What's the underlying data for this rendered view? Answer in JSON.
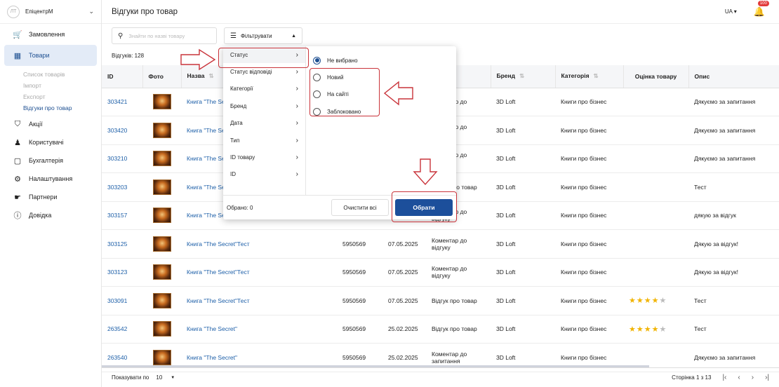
{
  "sidebar": {
    "avatar": "ЛТ",
    "company": "ЕпіцентрМ",
    "items": [
      {
        "label": "Замовлення",
        "icon": "cart-icon"
      },
      {
        "label": "Товари",
        "icon": "box-icon"
      },
      {
        "label": "Акції",
        "icon": "promo-icon"
      },
      {
        "label": "Користувачі",
        "icon": "users-icon"
      },
      {
        "label": "Бухгалтерія",
        "icon": "wallet-icon"
      },
      {
        "label": "Налаштування",
        "icon": "gear-icon"
      },
      {
        "label": "Партнери",
        "icon": "handshake-icon"
      },
      {
        "label": "Довідка",
        "icon": "help-icon"
      }
    ],
    "subitems": [
      "Список товарів",
      "Імпорт",
      "Експорт",
      "Відгуки про товар"
    ]
  },
  "header": {
    "title": "Відгуки про товар",
    "lang": "UA",
    "notif_count": "100"
  },
  "toolbar": {
    "search_placeholder": "Знайти по назві товару",
    "filter_label": "Фільтрувати"
  },
  "count_label": "Відгуків: 128",
  "table": {
    "headers": {
      "id": "ID",
      "photo": "Фото",
      "name": "Назва",
      "brand": "Бренд",
      "category": "Категорія",
      "rating": "Оцінка товару",
      "desc": "Опис"
    },
    "rows": [
      {
        "id": "303421",
        "name": "Книга \"The Secret\"Тесть",
        "code": "",
        "date": "",
        "type": "Коментар до",
        "brand": "3D Loft",
        "category": "Книги про бізнес",
        "rating": 0,
        "desc": "Дякуємо за запитання"
      },
      {
        "id": "303420",
        "name": "Книга \"The Secret\"Тесть",
        "code": "",
        "date": "",
        "type": "Коментар до відгуку",
        "brand": "3D Loft",
        "category": "Книги про бізнес",
        "rating": 0,
        "desc": "Дякуємо за запитання"
      },
      {
        "id": "303210",
        "name": "Книга \"The Secret\"Тест",
        "code": "",
        "date": "",
        "type": "Коментар до відгуку",
        "brand": "3D Loft",
        "category": "Книги про бізнес",
        "rating": 0,
        "desc": "Дякуємо за запитання"
      },
      {
        "id": "303203",
        "name": "Книга \"The Secret\"Тест",
        "code": "",
        "date": "",
        "type": "Відгук про товар",
        "brand": "3D Loft",
        "category": "Книги про бізнес",
        "rating": 0,
        "desc": "Тест"
      },
      {
        "id": "303157",
        "name": "Книга \"The Secret\"Тест",
        "code": "",
        "date": "",
        "type": "Коментар до відгуку",
        "brand": "3D Loft",
        "category": "Книги про бізнес",
        "rating": 0,
        "desc": "дякую за відгук"
      },
      {
        "id": "303125",
        "name": "Книга \"The Secret\"Тест",
        "code": "5950569",
        "date": "07.05.2025",
        "type": "Коментар до відгуку",
        "brand": "3D Loft",
        "category": "Книги про бізнес",
        "rating": 0,
        "desc": "Дякую за відгук!"
      },
      {
        "id": "303123",
        "name": "Книга \"The Secret\"Тест",
        "code": "5950569",
        "date": "07.05.2025",
        "type": "Коментар до відгуку",
        "brand": "3D Loft",
        "category": "Книги про бізнес",
        "rating": 0,
        "desc": "Дякую за відгук!"
      },
      {
        "id": "303091",
        "name": "Книга \"The Secret\"Тест",
        "code": "5950569",
        "date": "07.05.2025",
        "type": "Відгук про товар",
        "brand": "3D Loft",
        "category": "Книги про бізнес",
        "rating": 4,
        "desc": "Тест"
      },
      {
        "id": "263542",
        "name": "Книга \"The Secret\"",
        "code": "5950569",
        "date": "25.02.2025",
        "type": "Відгук про товар",
        "brand": "3D Loft",
        "category": "Книги про бізнес",
        "rating": 4,
        "desc": "Тест"
      },
      {
        "id": "263540",
        "name": "Книга \"The Secret\"",
        "code": "5950569",
        "date": "25.02.2025",
        "type": "Коментар до запитання",
        "brand": "3D Loft",
        "category": "Книги про бізнес",
        "rating": 0,
        "desc": "Дякуємо за запитання"
      }
    ]
  },
  "footer": {
    "rows_label": "Показувати по",
    "rows_value": "10",
    "page_label": "Сторінка 1 з 13"
  },
  "filter_panel": {
    "categories": [
      "Статус",
      "Статус відповіді",
      "Категорії",
      "Бренд",
      "Дата",
      "Тип",
      "ID товару",
      "ID"
    ],
    "options": [
      "Не вибрано",
      "Новий",
      "На сайті",
      "Заблоковано"
    ],
    "selected_option": 0,
    "selected_label": "Обрано: 0",
    "clear_label": "Очистити всі",
    "apply_label": "Обрати"
  },
  "colors": {
    "accent": "#1c4f9b",
    "annotation": "#c9333a",
    "star": "#f1b400"
  }
}
